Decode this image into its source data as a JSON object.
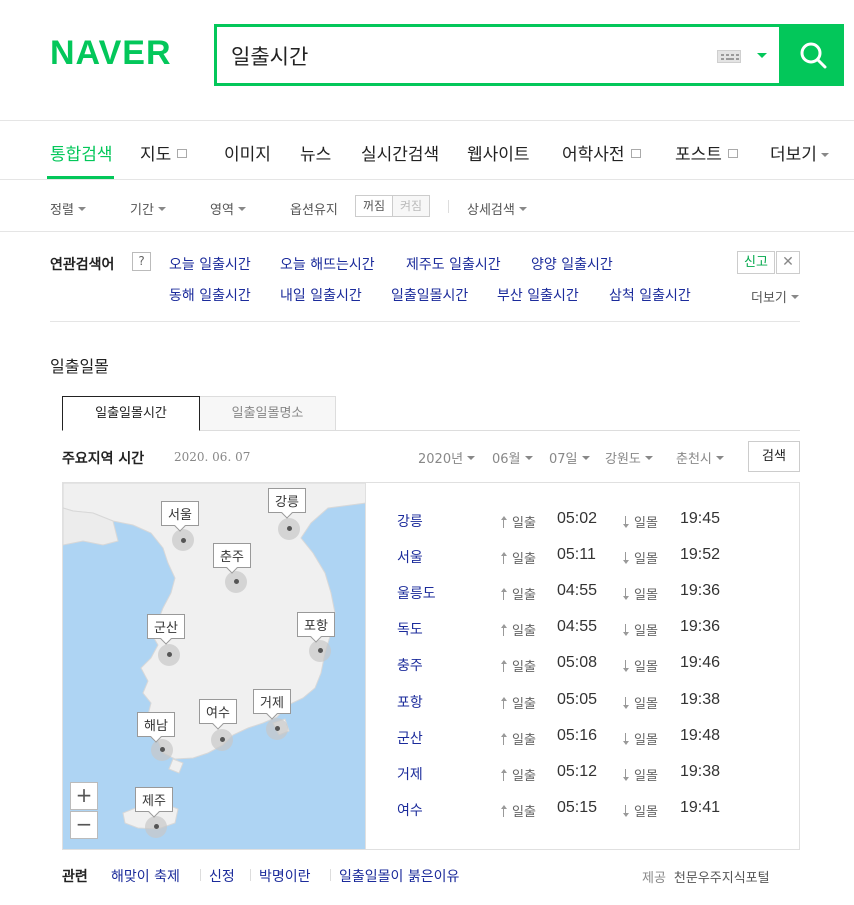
{
  "header": {
    "logo": "NAVER",
    "search_value": "일출시간"
  },
  "tabs": [
    {
      "label": "통합검색",
      "active": true
    },
    {
      "label": "지도"
    },
    {
      "label": "이미지"
    },
    {
      "label": "뉴스"
    },
    {
      "label": "실시간검색"
    },
    {
      "label": "웹사이트"
    },
    {
      "label": "어학사전"
    },
    {
      "label": "포스트"
    },
    {
      "label": "더보기"
    }
  ],
  "options": {
    "sort": "정렬",
    "period": "기간",
    "area": "영역",
    "keep": "옵션유지",
    "on": "꺼짐",
    "off": "켜짐",
    "detail": "상세검색"
  },
  "related": {
    "title": "연관검색어",
    "help": "?",
    "row1": [
      "오늘 일출시간",
      "오늘 해뜨는시간",
      "제주도 일출시간",
      "양양 일출시간"
    ],
    "row2": [
      "동해 일출시간",
      "내일 일출시간",
      "일출일몰시간",
      "부산 일출시간",
      "삼척 일출시간"
    ],
    "report": "신고",
    "close": "✕",
    "more": "더보기"
  },
  "sun": {
    "section_title": "일출일몰",
    "tabs": [
      "일출일몰시간",
      "일출일몰명소"
    ],
    "major_title": "주요지역 시간",
    "date": "2020. 06. 07",
    "selectors": [
      "2020년",
      "06월",
      "07일",
      "강원도",
      "춘천시"
    ],
    "search_btn": "검색",
    "sunrise_label": "일출",
    "sunset_label": "일몰",
    "map_labels": [
      "서울",
      "강릉",
      "춘주",
      "군산",
      "포항",
      "해남",
      "여수",
      "거제",
      "제주"
    ],
    "zoom_in": "+",
    "zoom_out": "−",
    "rows": [
      {
        "city": "강릉",
        "rise": "05:02",
        "set": "19:45"
      },
      {
        "city": "서울",
        "rise": "05:11",
        "set": "19:52"
      },
      {
        "city": "울릉도",
        "rise": "04:55",
        "set": "19:36"
      },
      {
        "city": "독도",
        "rise": "04:55",
        "set": "19:36"
      },
      {
        "city": "충주",
        "rise": "05:08",
        "set": "19:46"
      },
      {
        "city": "포항",
        "rise": "05:05",
        "set": "19:38"
      },
      {
        "city": "군산",
        "rise": "05:16",
        "set": "19:48"
      },
      {
        "city": "거제",
        "rise": "05:12",
        "set": "19:38"
      },
      {
        "city": "여수",
        "rise": "05:15",
        "set": "19:41"
      }
    ]
  },
  "footer": {
    "title": "관련",
    "links": [
      "해맞이 축제",
      "신정",
      "박명이란",
      "일출일몰이 붉은이유"
    ],
    "provider_label": "제공",
    "provider": "천문우주지식포털"
  },
  "colors": {
    "brand": "#03c75a",
    "link": "#1b2b9b"
  }
}
